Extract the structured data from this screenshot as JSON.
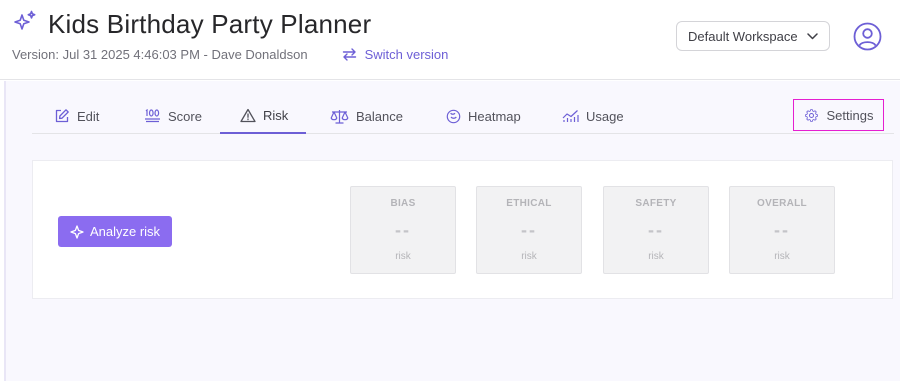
{
  "header": {
    "title": "Kids Birthday Party Planner",
    "version_text": "Version: Jul 31 2025 4:46:03 PM - Dave Donaldson",
    "switch_version_label": "Switch version",
    "workspace_selected": "Default Workspace",
    "icons": {
      "title": "sparkle-icon",
      "switch": "swap-arrows-icon",
      "workspace": "chevron-down-icon",
      "avatar": "user-circle-icon"
    }
  },
  "tabs": [
    {
      "label": "Edit",
      "icon": "edit-icon"
    },
    {
      "label": "Score",
      "icon": "score-100-icon"
    },
    {
      "label": "Risk",
      "icon": "warning-triangle-icon",
      "active": true
    },
    {
      "label": "Balance",
      "icon": "scale-icon"
    },
    {
      "label": "Heatmap",
      "icon": "heatmap-icon"
    },
    {
      "label": "Usage",
      "icon": "usage-chart-icon"
    }
  ],
  "settings_label": "Settings",
  "analyze_label": "Analyze risk",
  "risk_cards": [
    {
      "label": "BIAS",
      "value": "--",
      "unit": "risk"
    },
    {
      "label": "ETHICAL",
      "value": "--",
      "unit": "risk"
    },
    {
      "label": "SAFETY",
      "value": "--",
      "unit": "risk"
    },
    {
      "label": "OVERALL",
      "value": "--",
      "unit": "risk"
    }
  ],
  "colors": {
    "accent": "#6d5fd6",
    "button": "#8b6cf0",
    "highlight": "#e51fd0",
    "background": "#f9f8fe"
  }
}
